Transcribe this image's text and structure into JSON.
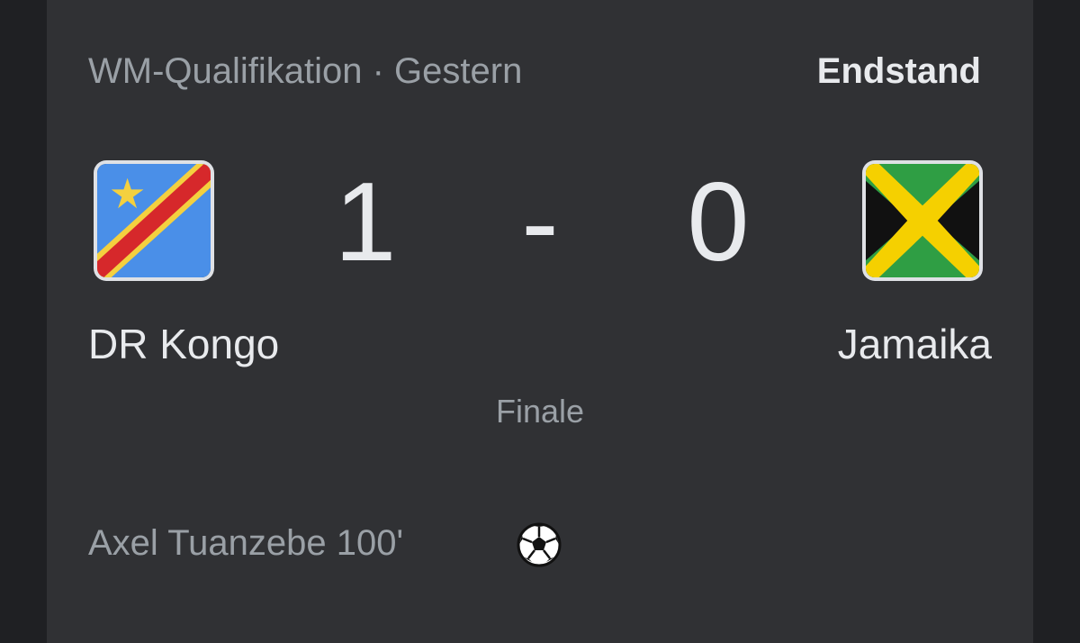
{
  "match": {
    "competition_date": "WM-Qualifikation · Gestern",
    "state": "Endstand",
    "home": {
      "name": "DR Kongo",
      "score": "1",
      "flag_icon": "dr-congo-flag-icon"
    },
    "separator": "-",
    "away": {
      "name": "Jamaika",
      "score": "0",
      "flag_icon": "jamaica-flag-icon"
    },
    "status": "Finale",
    "goals": [
      {
        "scorer": "Axel Tuanzebe 100'",
        "icon": "soccer-ball-icon"
      }
    ]
  },
  "colors": {
    "card_bg": "#303134",
    "page_bg": "#1f2023",
    "text_primary": "#e8eaed",
    "text_secondary": "#9aa0a6"
  }
}
